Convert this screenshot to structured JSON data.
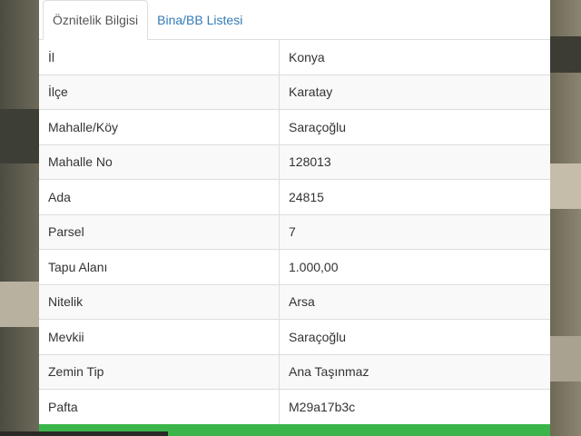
{
  "tabs": [
    {
      "label": "Öznitelik Bilgisi",
      "active": true
    },
    {
      "label": "Bina/BB Listesi",
      "active": false
    }
  ],
  "attributes": [
    {
      "key": "İl",
      "value": "Konya"
    },
    {
      "key": "İlçe",
      "value": "Karatay"
    },
    {
      "key": "Mahalle/Köy",
      "value": "Saraçoğlu"
    },
    {
      "key": "Mahalle No",
      "value": "128013"
    },
    {
      "key": "Ada",
      "value": "24815"
    },
    {
      "key": "Parsel",
      "value": "7"
    },
    {
      "key": "Tapu Alanı",
      "value": "1.000,00"
    },
    {
      "key": "Nitelik",
      "value": "Arsa"
    },
    {
      "key": "Mevkii",
      "value": "Saraçoğlu"
    },
    {
      "key": "Zemin Tip",
      "value": "Ana Taşınmaz"
    },
    {
      "key": "Pafta",
      "value": "M29a17b3c"
    }
  ],
  "colors": {
    "accent_green": "#3bb54a",
    "link_blue": "#337ab7"
  }
}
